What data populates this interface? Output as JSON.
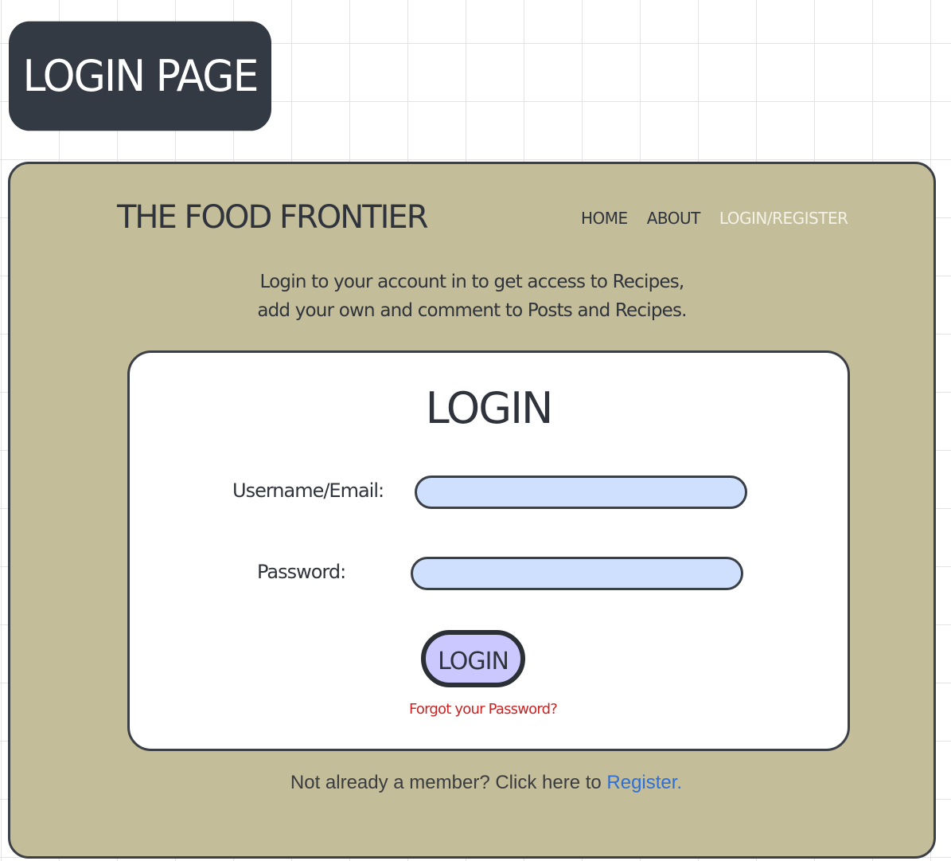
{
  "page_badge": {
    "label": "LOGIN PAGE"
  },
  "header": {
    "brand": "THE FOOD FRONTIER",
    "nav": [
      {
        "label": "HOME",
        "active": false
      },
      {
        "label": "ABOUT",
        "active": false
      },
      {
        "label": "LOGIN/REGISTER",
        "active": true
      }
    ]
  },
  "intro": {
    "line1": "Login to your account in to get access to Recipes,",
    "line2": "add your own and comment to Posts and Recipes."
  },
  "login_form": {
    "title": "LOGIN",
    "username_label": "Username/Email:",
    "username_value": "",
    "password_label": "Password:",
    "password_value": "",
    "submit_label": "LOGIN",
    "forgot_label": "Forgot your Password?"
  },
  "register": {
    "prompt": "Not already a member? Click here to ",
    "link_label": "Register."
  },
  "colors": {
    "frame_background": "#c3bd9a",
    "badge_background": "#333a44",
    "input_background": "#cfe0ff",
    "button_background": "#cbc7ff",
    "forgot_link": "#cc2222",
    "register_link": "#2d6fd6",
    "nav_active": "#f4f2e6"
  }
}
